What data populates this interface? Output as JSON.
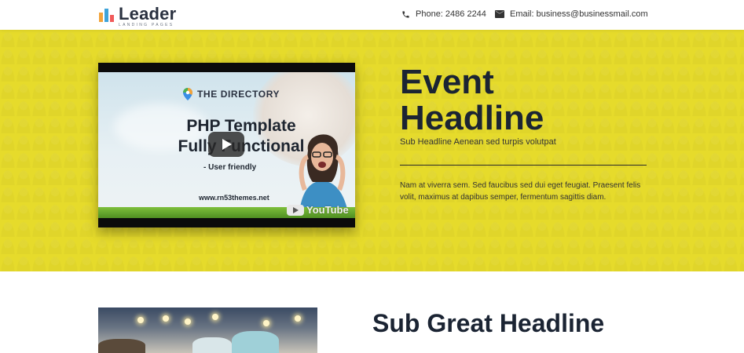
{
  "header": {
    "logo_name": "Leader",
    "logo_sub": "LANDING PAGES",
    "phone": "Phone: 2486 2244",
    "email": "Email: business@businessmail.com",
    "icons": [
      "phone-icon",
      "mail-icon"
    ]
  },
  "hero": {
    "headline_line1": "Event",
    "headline_line2": "Headline",
    "subheadline": "Sub Headline Aenean sed turpis volutpat",
    "body": "Nam at viverra sem. Sed faucibus sed dui eget feugiat. Praesent felis volit, maximus at dapibus semper, fermentum sagittis diam.",
    "background_color": "#e4da2b"
  },
  "video": {
    "brand": "THE DIRECTORY",
    "title_line1": "PHP Template",
    "title_line2": "Fully Functional",
    "subtitle": "- User friendly",
    "url": "www.rn53themes.net",
    "platform": "YouTube"
  },
  "section2": {
    "headline": "Sub Great Headline"
  }
}
